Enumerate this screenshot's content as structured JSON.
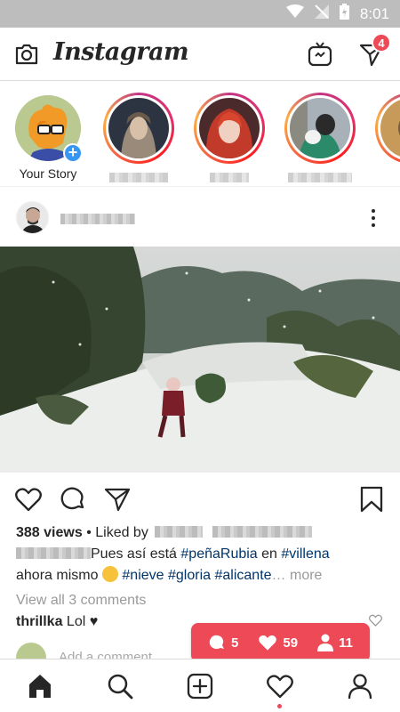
{
  "status_bar": {
    "time": "8:01"
  },
  "header": {
    "app_title": "Instagram",
    "direct_badge": "4"
  },
  "stories": [
    {
      "label": "Your Story",
      "own": true
    }
  ],
  "post": {
    "views": "388 views",
    "liked_by_prefix": "• Liked by",
    "caption_text": "Pues así está",
    "caption_tag1": "#peñaRubia",
    "caption_mid": "en",
    "caption_tag2": "#villena",
    "caption_line2_a": "ahora mismo",
    "caption_tag3": "#nieve",
    "caption_tag4": "#gloria",
    "caption_tag5": "#alicante",
    "caption_more_ellipsis": "…",
    "caption_more": "more",
    "view_comments": "View all 3 comments",
    "comment_user": "thrillka",
    "comment_text": "Lol ♥",
    "add_comment_placeholder": "Add a comment..."
  },
  "activity_popup": {
    "comments": "5",
    "likes": "59",
    "follows": "11"
  },
  "colors": {
    "accent_red": "#ed4956",
    "link_blue": "#003569",
    "plus_blue": "#3897f0"
  }
}
